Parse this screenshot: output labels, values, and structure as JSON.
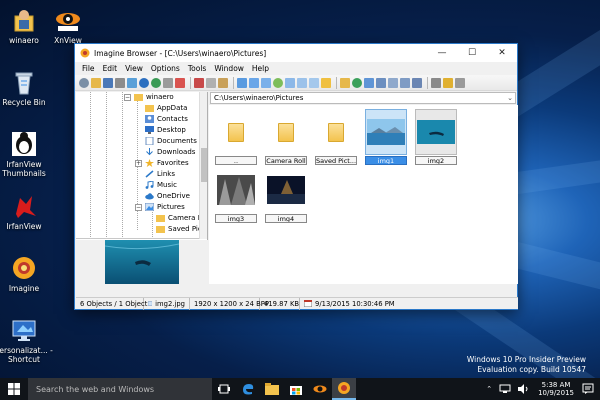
{
  "desktop": {
    "icons": [
      {
        "label": "winaero",
        "icon": "user-folder-icon"
      },
      {
        "label": "XnView",
        "icon": "xnview-icon"
      },
      {
        "label": "Recycle Bin",
        "icon": "recycle-bin-icon"
      },
      {
        "label": "IrfanView Thumbnails",
        "icon": "irfanview-thumbnails-icon"
      },
      {
        "label": "IrfanView",
        "icon": "irfanview-icon"
      },
      {
        "label": "Imagine",
        "icon": "imagine-icon"
      },
      {
        "label": "Personalizat... - Shortcut",
        "icon": "personalization-shortcut-icon"
      }
    ],
    "watermark": {
      "line1": "Windows 10 Pro Insider Preview",
      "line2": "Evaluation copy. Build 10547"
    }
  },
  "window": {
    "title": "Imagine Browser - [C:\\Users\\winaero\\Pictures]",
    "controls": {
      "minimize": "—",
      "maximize": "☐",
      "close": "✕"
    },
    "menu": [
      "File",
      "Edit",
      "View",
      "Options",
      "Tools",
      "Window",
      "Help"
    ],
    "address": "C:\\Users\\winaero\\Pictures",
    "tree": [
      {
        "label": "winaero",
        "level": 0,
        "expanded": true
      },
      {
        "label": "AppData",
        "level": 1
      },
      {
        "label": "Contacts",
        "level": 1
      },
      {
        "label": "Desktop",
        "level": 1
      },
      {
        "label": "Documents",
        "level": 1
      },
      {
        "label": "Downloads",
        "level": 1
      },
      {
        "label": "Favorites",
        "level": 1
      },
      {
        "label": "Links",
        "level": 1
      },
      {
        "label": "Music",
        "level": 1
      },
      {
        "label": "OneDrive",
        "level": 1
      },
      {
        "label": "Pictures",
        "level": 1,
        "expanded": true
      },
      {
        "label": "Camera R",
        "level": 2
      },
      {
        "label": "Saved Pic",
        "level": 2
      }
    ],
    "files": [
      {
        "label": "..",
        "type": "folder"
      },
      {
        "label": "Camera Roll",
        "type": "folder"
      },
      {
        "label": "Saved Pict...",
        "type": "folder"
      },
      {
        "label": "img1",
        "type": "image",
        "state": "selected"
      },
      {
        "label": "img2",
        "type": "image",
        "state": "current"
      },
      {
        "label": "img3",
        "type": "image"
      },
      {
        "label": "img4",
        "type": "image"
      }
    ],
    "status": {
      "objects": "6 Objects / 1 Object",
      "file": "img2.jpg",
      "dimensions": "1920 x 1200 x 24 BPP",
      "size": "419.87 KB",
      "date": "9/13/2015 10:30:46 PM"
    }
  },
  "taskbar": {
    "search_placeholder": "Search the web and Windows",
    "time": "5:38 AM",
    "date": "10/9/2015"
  },
  "colors": {
    "accent": "#2b79c9",
    "taskbar": "#101419",
    "selection": "#3a8ee6"
  }
}
